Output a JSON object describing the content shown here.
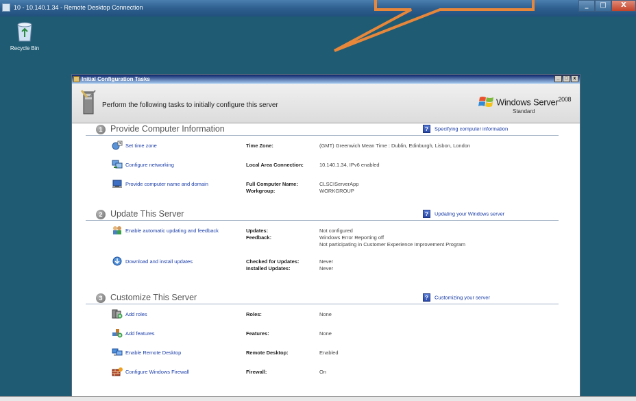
{
  "rdp": {
    "title": "10 - 10.140.1.34 - Remote Desktop Connection",
    "controls": {
      "minimize": "_",
      "maximize": "□",
      "close": "X"
    }
  },
  "desktop": {
    "recycle_bin_label": "Recycle Bin"
  },
  "window": {
    "title": "Initial Configuration Tasks",
    "controls": {
      "minimize": "_",
      "maximize": "□",
      "close": "x"
    },
    "header_text": "Perform the following tasks to initially configure this server",
    "logo": {
      "name": "Windows Server",
      "version": "2008",
      "edition": "Standard"
    }
  },
  "sections": [
    {
      "number": "1",
      "title": "Provide Computer Information",
      "help": "Specifying computer information",
      "tasks": [
        {
          "icon": "clock-globe-icon",
          "link": "Set time zone",
          "labels": [
            "Time Zone:"
          ],
          "values": [
            "(GMT) Greenwich Mean Time : Dublin, Edinburgh, Lisbon, London"
          ]
        },
        {
          "icon": "network-icon",
          "link": "Configure networking",
          "labels": [
            "Local Area Connection:"
          ],
          "values": [
            "10.140.1.34, IPv6 enabled"
          ]
        },
        {
          "icon": "computer-name-icon",
          "link": "Provide computer name and domain",
          "labels": [
            "Full Computer Name:",
            "Workgroup:"
          ],
          "values": [
            "CLSCIServerApp",
            "WORKGROUP"
          ]
        }
      ]
    },
    {
      "number": "2",
      "title": "Update This Server",
      "help": "Updating your Windows server",
      "tasks": [
        {
          "icon": "users-update-icon",
          "link": "Enable automatic updating and feedback",
          "labels": [
            "Updates:",
            "Feedback:"
          ],
          "values": [
            "Not configured",
            "Windows Error Reporting off",
            "Not participating in Customer Experience Improvement Program"
          ]
        },
        {
          "icon": "download-updates-icon",
          "link": "Download and install updates",
          "labels": [
            "Checked for Updates:",
            "Installed Updates:"
          ],
          "values": [
            "Never",
            "Never"
          ]
        }
      ]
    },
    {
      "number": "3",
      "title": "Customize This Server",
      "help": "Customizing your server",
      "tasks": [
        {
          "icon": "add-roles-icon",
          "link": "Add roles",
          "labels": [
            "Roles:"
          ],
          "values": [
            "None"
          ]
        },
        {
          "icon": "add-features-icon",
          "link": "Add features",
          "labels": [
            "Features:"
          ],
          "values": [
            "None"
          ]
        },
        {
          "icon": "remote-desktop-icon",
          "link": "Enable Remote Desktop",
          "labels": [
            "Remote Desktop:"
          ],
          "values": [
            "Enabled"
          ]
        },
        {
          "icon": "firewall-icon",
          "link": "Configure Windows Firewall",
          "labels": [
            "Firewall:"
          ],
          "values": [
            "On"
          ]
        }
      ]
    }
  ],
  "colors": {
    "desktop_bg": "#1f5c74",
    "link": "#1b3ea8",
    "callout": "#e8873a"
  }
}
